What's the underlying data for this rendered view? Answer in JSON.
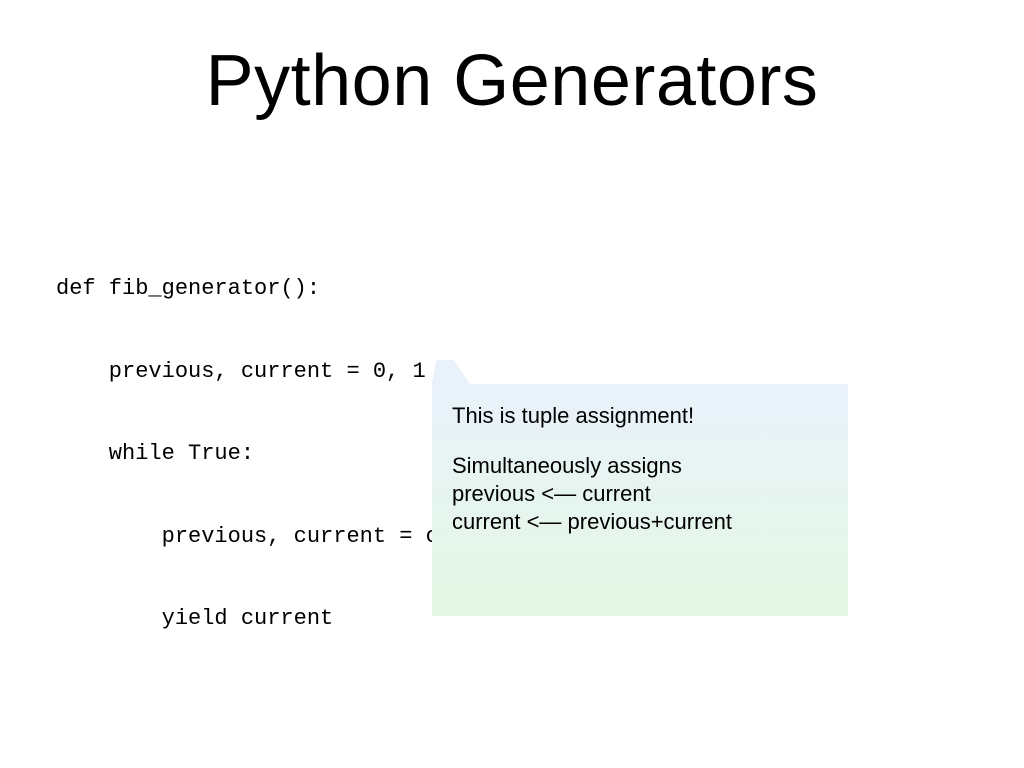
{
  "title": "Python Generators",
  "code": {
    "lines": [
      "def fib_generator():",
      "    previous, current = 0, 1",
      "    while True:",
      "        previous, current = current, previous+current",
      "        yield current"
    ]
  },
  "callout": {
    "line1": "This is tuple assignment!",
    "line2": "Simultaneously assigns",
    "line3": "previous <— current",
    "line4": "current <— previous+current"
  }
}
